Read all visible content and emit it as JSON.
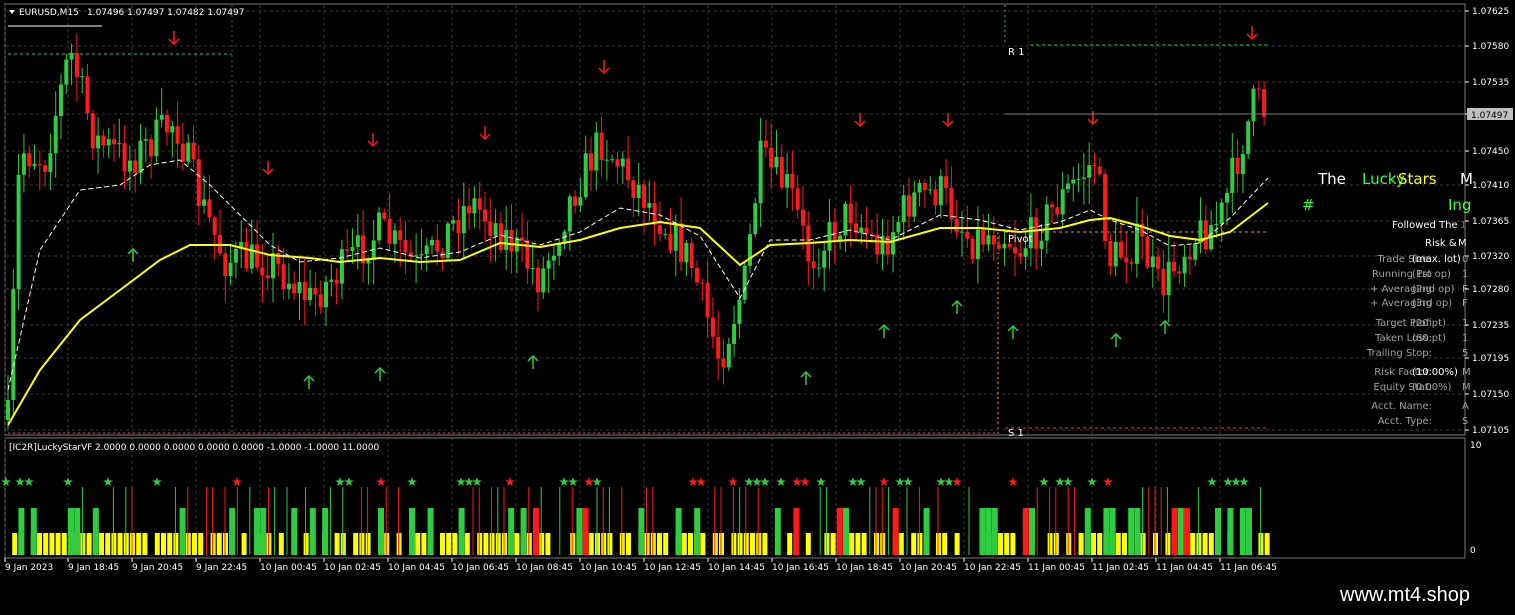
{
  "header": {
    "symbol": "EURUSD,M15",
    "ohlc": "1.07496 1.07497 1.07482 1.07497"
  },
  "price_axis": {
    "labels": [
      "1.07625",
      "1.07580",
      "1.07535",
      "1.07495",
      "1.07450",
      "1.07410",
      "1.07365",
      "1.07320",
      "1.07280",
      "1.07235",
      "1.07195",
      "1.07150",
      "1.07105"
    ],
    "current": "1.07497"
  },
  "levels": {
    "r1": "R 1",
    "pivot": "Pivot",
    "s1": "S 1"
  },
  "indicator": {
    "title": "[IC2R]LuckyStarVF",
    "values": "2.0000 0.0000 0.0000 0.0000 0.0000 -1.0000 -1.0000 11.0000",
    "axis_top": "10",
    "axis_bottom": "0"
  },
  "time_axis": [
    "9 Jan 2023",
    "9 Jan 18:45",
    "9 Jan 20:45",
    "9 Jan 22:45",
    "10 Jan 00:45",
    "10 Jan 02:45",
    "10 Jan 04:45",
    "10 Jan 06:45",
    "10 Jan 08:45",
    "10 Jan 10:45",
    "10 Jan 12:45",
    "10 Jan 14:45",
    "10 Jan 16:45",
    "10 Jan 18:45",
    "10 Jan 20:45",
    "10 Jan 22:45",
    "11 Jan 00:45",
    "11 Jan 02:45",
    "11 Jan 04:45",
    "11 Jan 06:45"
  ],
  "ea_panel": {
    "title_the": "The",
    "title_lucky": "Lucky",
    "title_stars": "Stars",
    "title_m": "M",
    "hash": "#",
    "ing": "Ing",
    "followed": "Followed The",
    "followed_suffix": "1",
    "risk": "Risk &",
    "risk_suffix": "M",
    "rows": [
      {
        "label": "Trade Size:",
        "value": "(max. lot)",
        "extra": "0"
      },
      {
        "label": "Running Pro",
        "value": "(1st op)",
        "extra": "1"
      },
      {
        "label": "+ Averaging",
        "value": "(2nd op)",
        "extra": "F"
      },
      {
        "label": "+ Averaging",
        "value": "(3rd op)",
        "extra": "F"
      },
      {
        "label": "Target Profi",
        "value": "(20 pt)",
        "extra": "1"
      },
      {
        "label": "Taken Loss:",
        "value": "(60 pt)",
        "extra": "1"
      },
      {
        "label": "Trailing Stop:",
        "value": "",
        "extra": "5"
      },
      {
        "label": "Risk Factor:",
        "value": "(10.00%)",
        "extra": "M"
      },
      {
        "label": "Equity Stat:",
        "value": "(0.00%)",
        "extra": "M"
      },
      {
        "label": "Acct. Name:",
        "value": "",
        "extra": "A"
      },
      {
        "label": "Acct. Type:",
        "value": "",
        "extra": "S"
      }
    ]
  },
  "colors": {
    "bull": "#2ecc40",
    "bear": "#ff1a1a",
    "ma_yellow": "#ffff00",
    "ma_white": "#ffffff",
    "grid": "#3a3a3a",
    "green_text": "#3cff3c",
    "yellow_text": "#ffff00"
  },
  "watermark": "www.mt4.shop"
}
